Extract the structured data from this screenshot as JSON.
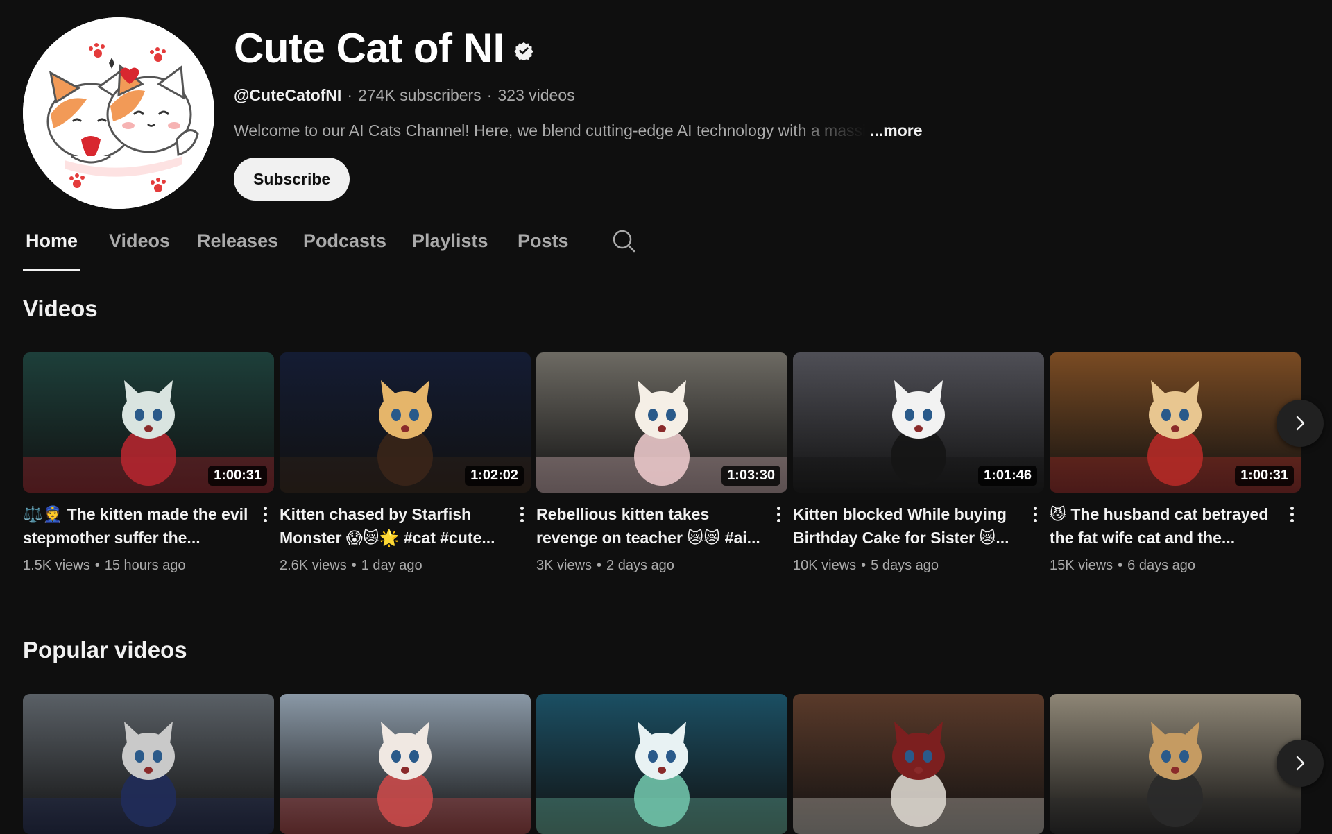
{
  "channel": {
    "name": "Cute Cat of NI",
    "handle": "@CuteCatofNI",
    "subscribers": "274K subscribers",
    "video_count": "323 videos",
    "meta_separator": "·",
    "description": "Welcome to our AI Cats Channel! Here, we blend cutting-edge AI technology with a massi",
    "more_label": "...more",
    "subscribe_label": "Subscribe",
    "verified_icon": "verified-badge-icon"
  },
  "tabs": [
    {
      "label": "Home",
      "active": true
    },
    {
      "label": "Videos",
      "active": false
    },
    {
      "label": "Releases",
      "active": false
    },
    {
      "label": "Podcasts",
      "active": false
    },
    {
      "label": "Playlists",
      "active": false
    },
    {
      "label": "Posts",
      "active": false
    }
  ],
  "search_icon": "search-icon",
  "sections": {
    "videos": {
      "title": "Videos",
      "items": [
        {
          "title": "⚖️👮 The kitten made the evil stepmother suffer the...",
          "duration": "1:00:31",
          "views": "1.5K views",
          "age": "15 hours ago",
          "palette": [
            "#1d3f3a",
            "#b3262f",
            "#d9e4e0"
          ]
        },
        {
          "title": "Kitten chased by Starfish Monster 😱😿🌟 #cat #cute...",
          "duration": "1:02:02",
          "views": "2.6K views",
          "age": "1 day ago",
          "palette": [
            "#141c33",
            "#3a2518",
            "#e5b56a"
          ]
        },
        {
          "title": "Rebellious kitten takes revenge on teacher 😿😿 #ai...",
          "duration": "1:03:30",
          "views": "3K views",
          "age": "2 days ago",
          "palette": [
            "#6d6a63",
            "#e9c6c9",
            "#f5efe6"
          ]
        },
        {
          "title": "Kitten blocked While buying Birthday Cake for Sister 😿...",
          "duration": "1:01:46",
          "views": "10K views",
          "age": "5 days ago",
          "palette": [
            "#4f4f56",
            "#151515",
            "#f2f2f2"
          ]
        },
        {
          "title": "😼 The husband cat betrayed the fat wife cat and the...",
          "duration": "1:00:31",
          "views": "15K views",
          "age": "6 days ago",
          "palette": [
            "#7a4b23",
            "#b42a27",
            "#e8c690"
          ]
        }
      ],
      "dot_separator": "•"
    },
    "popular": {
      "title": "Popular videos",
      "items": [
        {
          "palette": [
            "#5a6066",
            "#202c5a",
            "#c9c9c9"
          ]
        },
        {
          "palette": [
            "#8a98a6",
            "#c94a4a",
            "#f0e8e2"
          ]
        },
        {
          "palette": [
            "#1b4f63",
            "#6fc2a8",
            "#e8f2f3"
          ]
        },
        {
          "palette": [
            "#5a3a2a",
            "#d9d4cc",
            "#7c1f1f"
          ]
        },
        {
          "palette": [
            "#8e8676",
            "#2a2a2a",
            "#c59b62"
          ]
        }
      ]
    }
  },
  "next_icon": "chevron-right-icon",
  "colors": {
    "background": "#0f0f0f",
    "text_primary": "#f1f1f1",
    "text_secondary": "#aaaaaa",
    "divider": "#3f3f3f",
    "subscribe_bg": "#f1f1f1"
  }
}
